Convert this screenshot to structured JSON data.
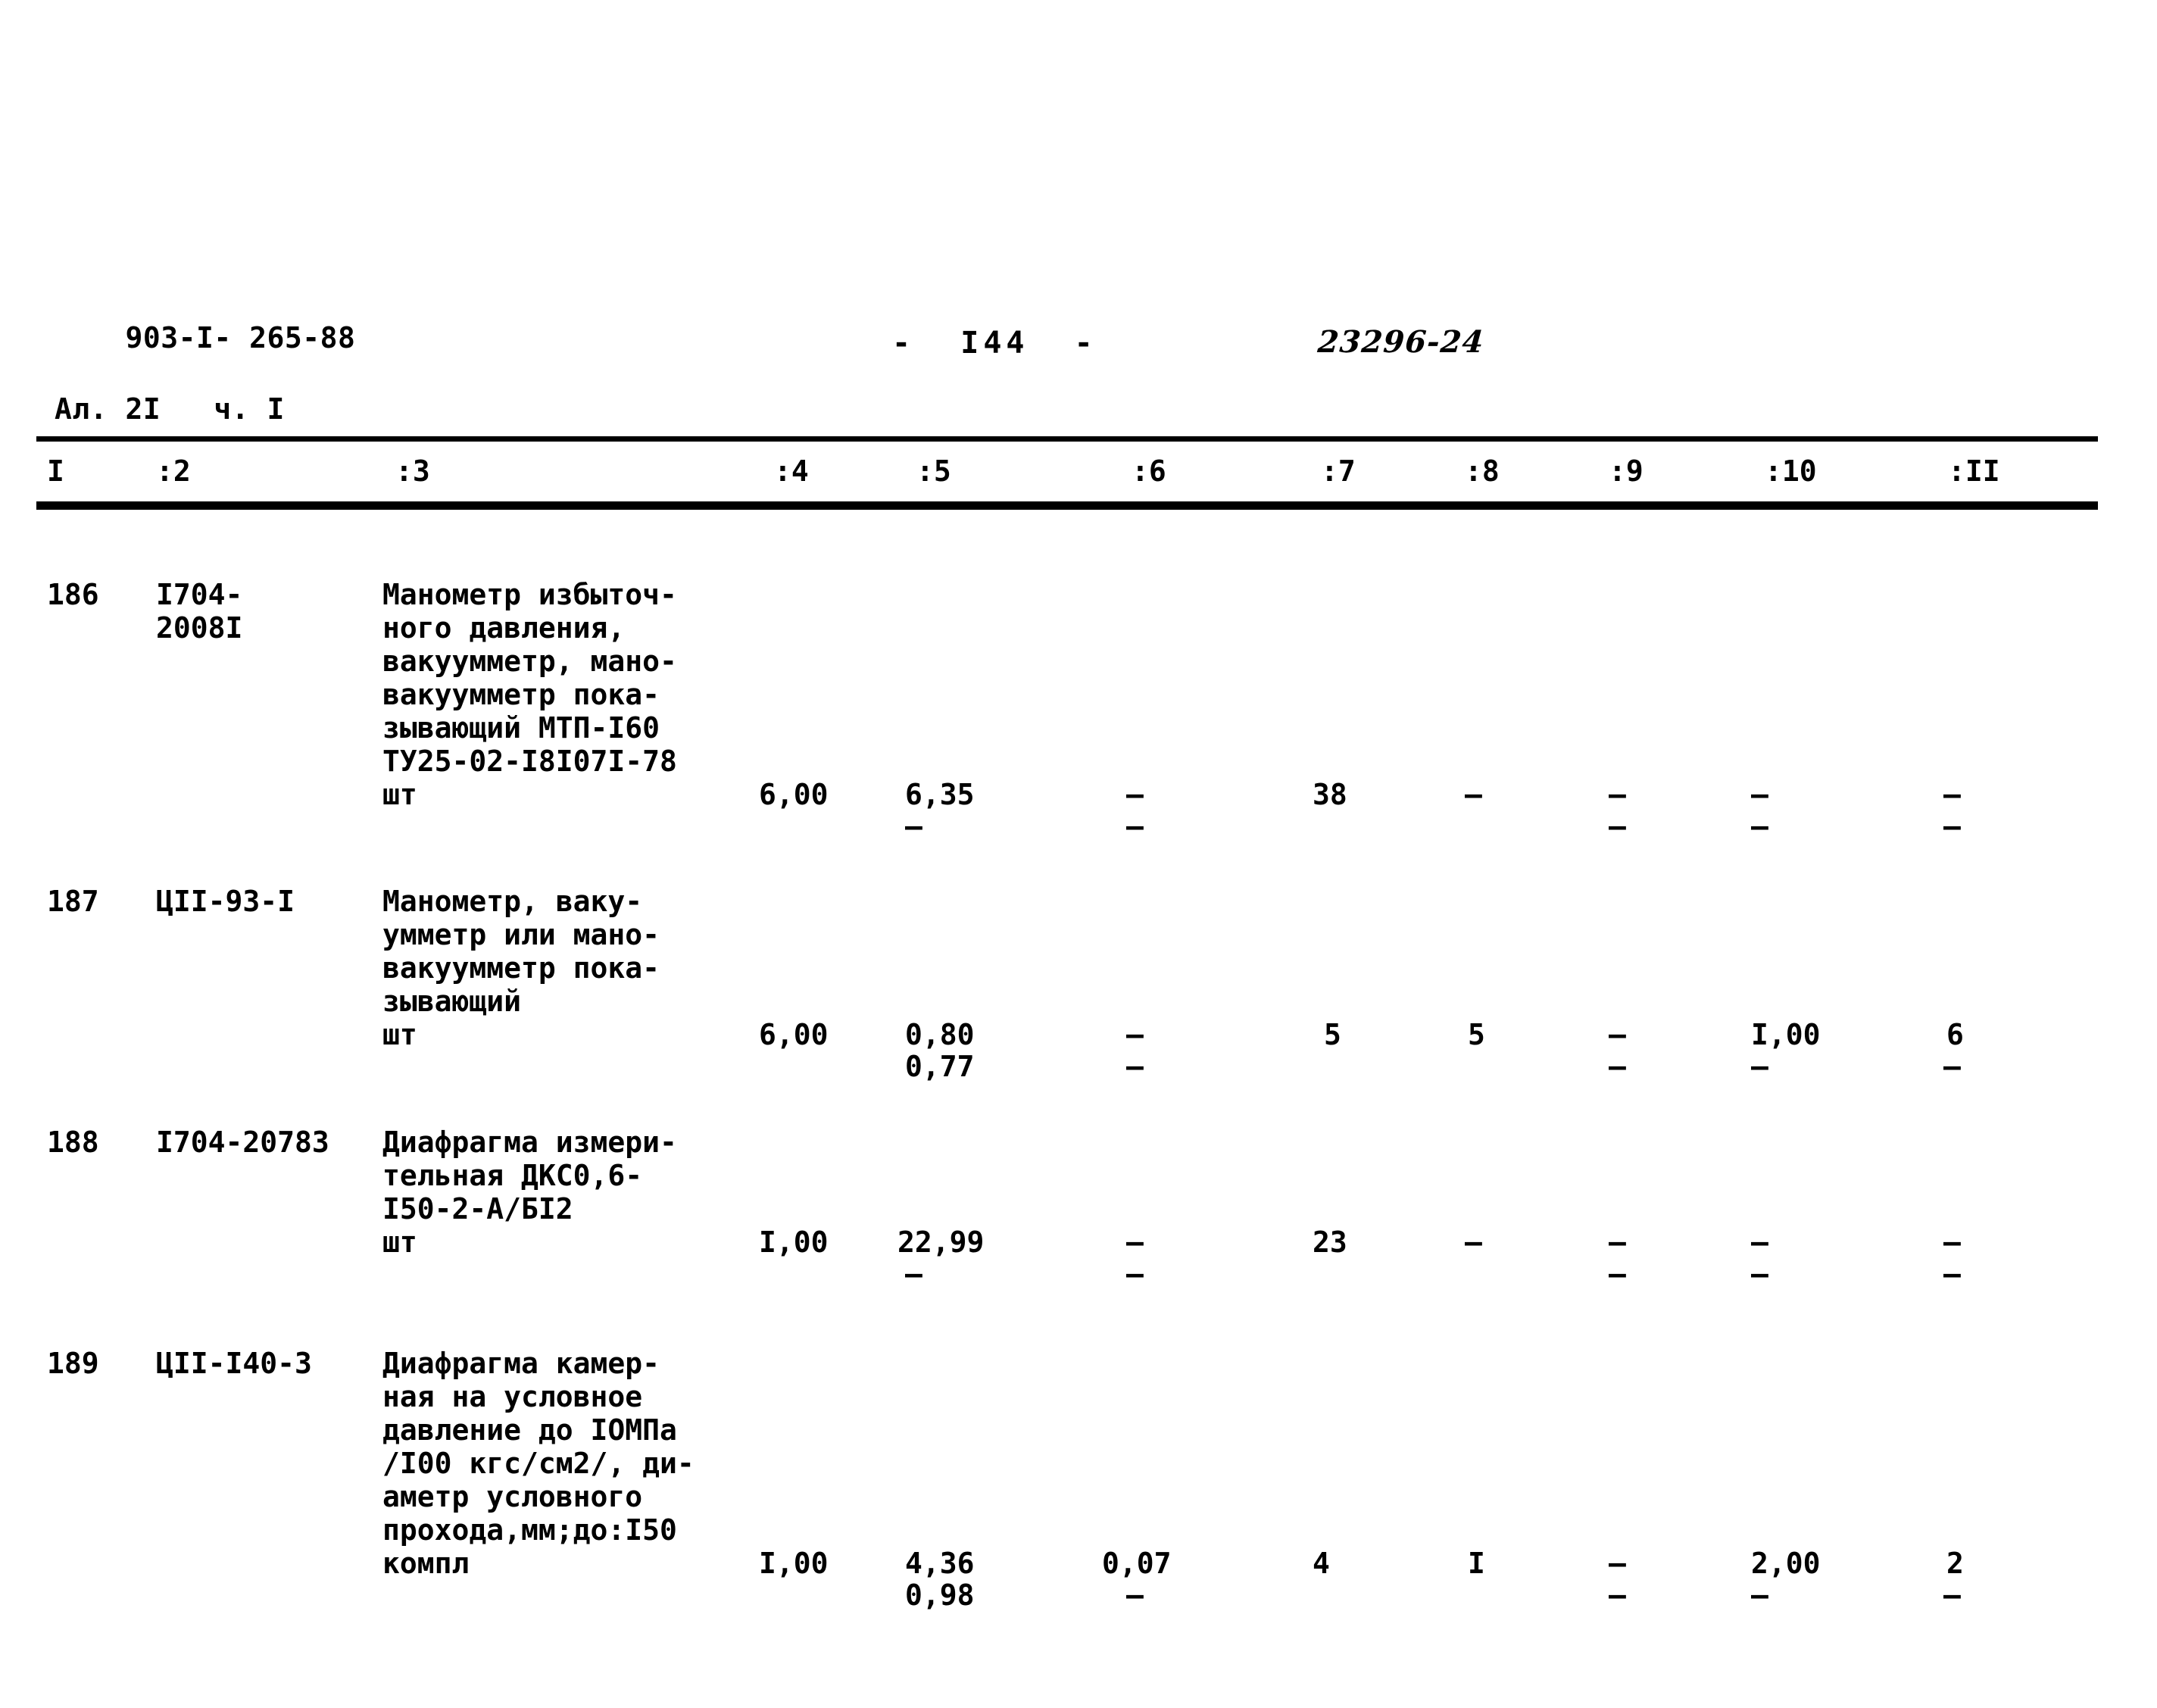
{
  "header": {
    "doc_code_line1": "903-I- 265-88",
    "doc_code_line2": "Ал. 2I   ч. I",
    "page_number": "-  I44  -",
    "stamp_number": "23296-24"
  },
  "table": {
    "columns": [
      "I",
      ":2",
      ":3",
      ":4",
      ":5",
      ":6",
      ":7",
      ":8",
      ":9",
      ":10",
      ":II"
    ],
    "rows": [
      {
        "num": "186",
        "code": "I704-\n2008I",
        "description": "Манометр избыточ-\nного давления,\nвакуумметр, мано-\nвакуумметр пока-\nзывающий МТП-I60\nТУ25-02-I8I07I-78",
        "unit": "шт",
        "c4": "6,00",
        "c4b": "",
        "c5": "6,35",
        "c5b": "–",
        "c6": "–",
        "c6b": "–",
        "c7": "38",
        "c7b": "",
        "c8": "–",
        "c8b": "",
        "c9": "–",
        "c9b": "–",
        "c10": "–",
        "c10b": "–",
        "c11": "–",
        "c11b": "–"
      },
      {
        "num": "187",
        "code": "ЦII-93-I",
        "description": "Манометр, ваку-\nумметр или мано-\nвакуумметр пока-\nзывающий",
        "unit": "шт",
        "c4": "6,00",
        "c4b": "",
        "c5": "0,80",
        "c5b": "0,77",
        "c6": "–",
        "c6b": "–",
        "c7": "5",
        "c7b": "",
        "c8": "5",
        "c8b": "",
        "c9": "–",
        "c9b": "–",
        "c10": "I,00",
        "c10b": "–",
        "c11": "6",
        "c11b": "–"
      },
      {
        "num": "188",
        "code": "I704-20783",
        "description": "Диафрагма измери-\nтельная ДКС0,6-\nI50-2-А/БI2",
        "unit": "шт",
        "c4": "I,00",
        "c4b": "",
        "c5": "22,99",
        "c5b": "–",
        "c6": "–",
        "c6b": "–",
        "c7": "23",
        "c7b": "",
        "c8": "–",
        "c8b": "",
        "c9": "–",
        "c9b": "–",
        "c10": "–",
        "c10b": "–",
        "c11": "–",
        "c11b": "–"
      },
      {
        "num": "189",
        "code": "ЦII-I40-3",
        "description": "Диафрагма камер-\nная на условное\nдавление до IОМПа\n/I00 кгс/см2/, ди-\nаметр условного\nпрохода,мм;до:I50",
        "unit": "компл",
        "c4": "I,00",
        "c4b": "",
        "c5": "4,36",
        "c5b": "0,98",
        "c6": "0,07",
        "c6b": "–",
        "c7": "4",
        "c7b": "",
        "c8": "I",
        "c8b": "",
        "c9": "–",
        "c9b": "–",
        "c10": "2,00",
        "c10b": "–",
        "c11": "2",
        "c11b": "–"
      }
    ]
  }
}
